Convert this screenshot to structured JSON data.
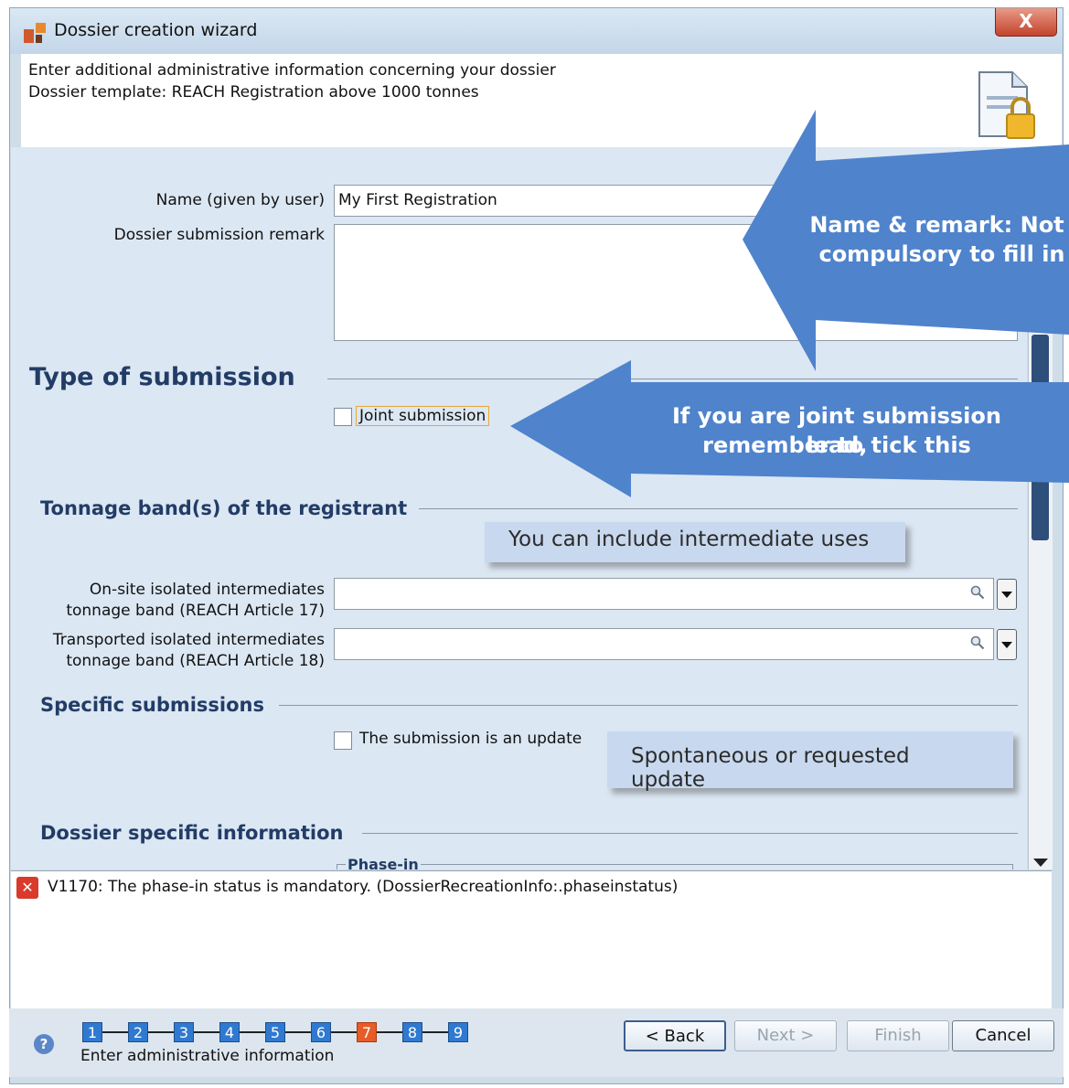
{
  "window": {
    "title": "Dossier creation wizard",
    "close_label": "X"
  },
  "header": {
    "line1": "Enter additional administrative information concerning your dossier",
    "line2": "Dossier template: REACH Registration above 1000 tonnes"
  },
  "form": {
    "name_label": "Name (given by user)",
    "name_value": "My First Registration",
    "remark_label": "Dossier submission remark",
    "remark_value": "",
    "type_of_submission": "Type of submission",
    "joint_submission_label": "Joint submission",
    "joint_submission_checked": false,
    "tonnage_title": "Tonnage band(s) of the registrant",
    "onsite_label_1": "On-site isolated intermediates",
    "onsite_label_2": "tonnage band (REACH Article 17)",
    "onsite_value": "",
    "transported_label_1": "Transported isolated intermediates",
    "transported_label_2": "tonnage band (REACH Article 18)",
    "transported_value": "",
    "specific_title": "Specific submissions",
    "update_label": "The submission is an update",
    "update_checked": false,
    "dossier_specific_title": "Dossier specific information",
    "phase_in_label": "Phase-in"
  },
  "annotations": {
    "name_remark_line1": "Name & remark: Not",
    "name_remark_line2": "compulsory to fill in",
    "joint_line1": "If you are joint submission lead,",
    "joint_line2": "remember to tick this",
    "intermediate": "You can include intermediate uses",
    "update": "Spontaneous or requested update"
  },
  "validation": {
    "message": "V1170: The phase-in status is mandatory. (DossierRecreationInfo:.phaseinstatus)"
  },
  "footer": {
    "steps": [
      "1",
      "2",
      "3",
      "4",
      "5",
      "6",
      "7",
      "8",
      "9"
    ],
    "current_step": "7",
    "caption": "Enter administrative information",
    "back": "< Back",
    "next": "Next >",
    "finish": "Finish",
    "cancel": "Cancel"
  },
  "colors": {
    "accent_arrow": "#4f83cc",
    "section_title": "#223c66",
    "active_step": "#e75c27",
    "step": "#2f7ad0"
  }
}
